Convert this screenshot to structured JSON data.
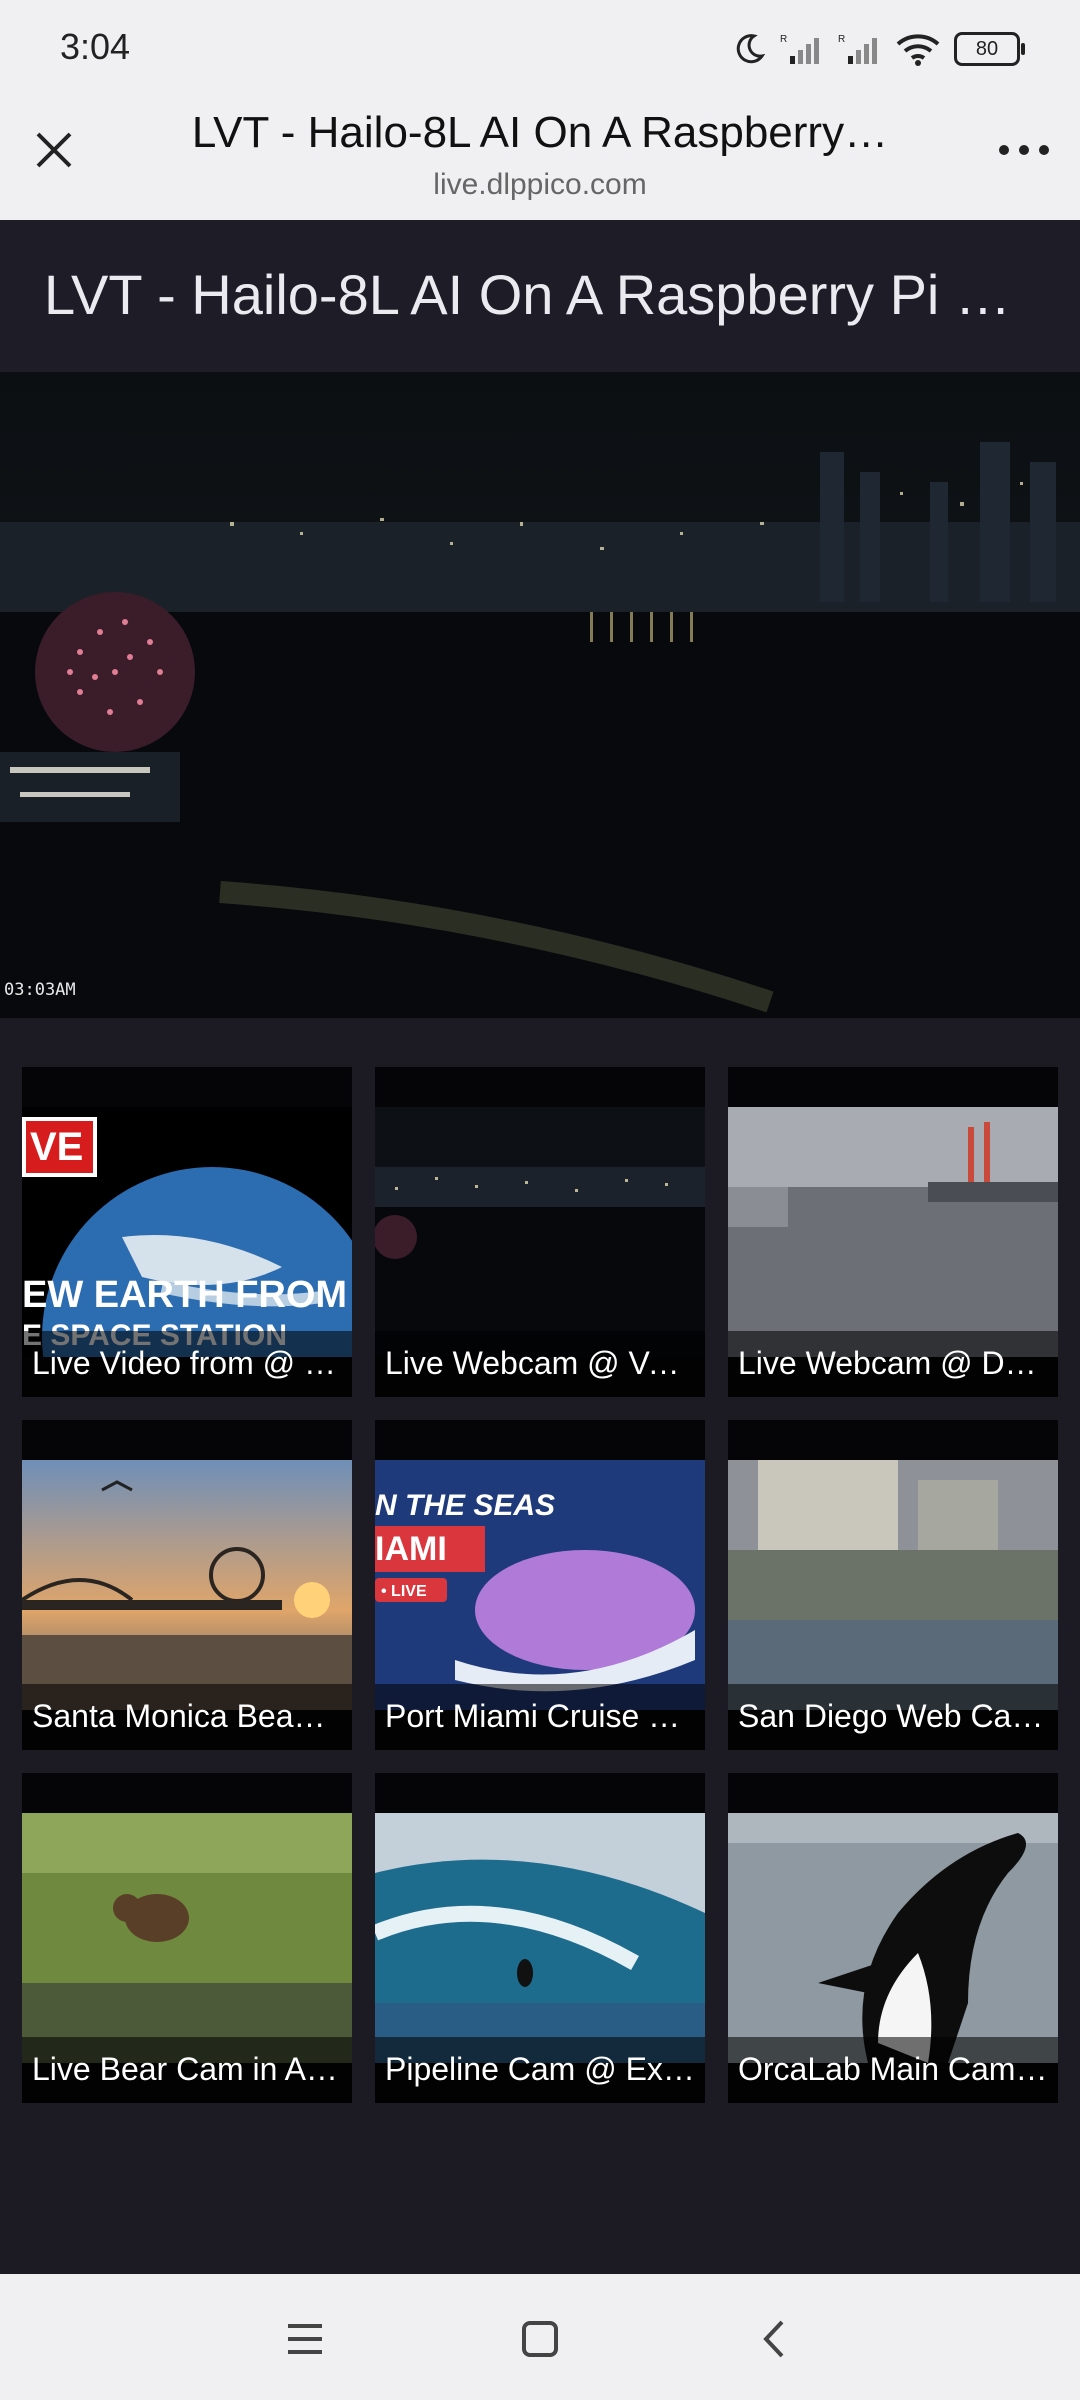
{
  "status_bar": {
    "time": "3:04",
    "battery": "80",
    "icons": [
      "moon-icon",
      "signal-icon",
      "signal-icon",
      "wifi-icon",
      "battery-icon"
    ]
  },
  "browser": {
    "title": "LVT - Hailo-8L AI On A Raspberry…",
    "url": "live.dlppico.com",
    "close_icon": "close-icon",
    "menu_icon": "more-icon"
  },
  "page": {
    "title": "LVT - Hailo-8L AI On A Raspberry Pi …",
    "video_timestamp": "03:03AM"
  },
  "tiles": [
    {
      "caption": "Live Video from @ …",
      "overlay_badge": "VE",
      "overlay_line1": "EW EARTH FROM",
      "overlay_line2": "E SPACE STATION"
    },
    {
      "caption": "Live Webcam @ Va…"
    },
    {
      "caption": "Live Webcam @ Du…"
    },
    {
      "caption": "Santa Monica Bea…"
    },
    {
      "caption": "Port Miami Cruise …",
      "overlay_line1": "N THE SEAS",
      "overlay_line2": "IAMI",
      "overlay_badge": "• LIVE"
    },
    {
      "caption": "San Diego Web Ca…"
    },
    {
      "caption": "Live Bear Cam in A…"
    },
    {
      "caption": "Pipeline Cam @ Ex…"
    },
    {
      "caption": "OrcaLab Main Cam…"
    }
  ],
  "nav_bar": {
    "icons": [
      "menu-icon",
      "home-icon",
      "back-icon"
    ]
  }
}
